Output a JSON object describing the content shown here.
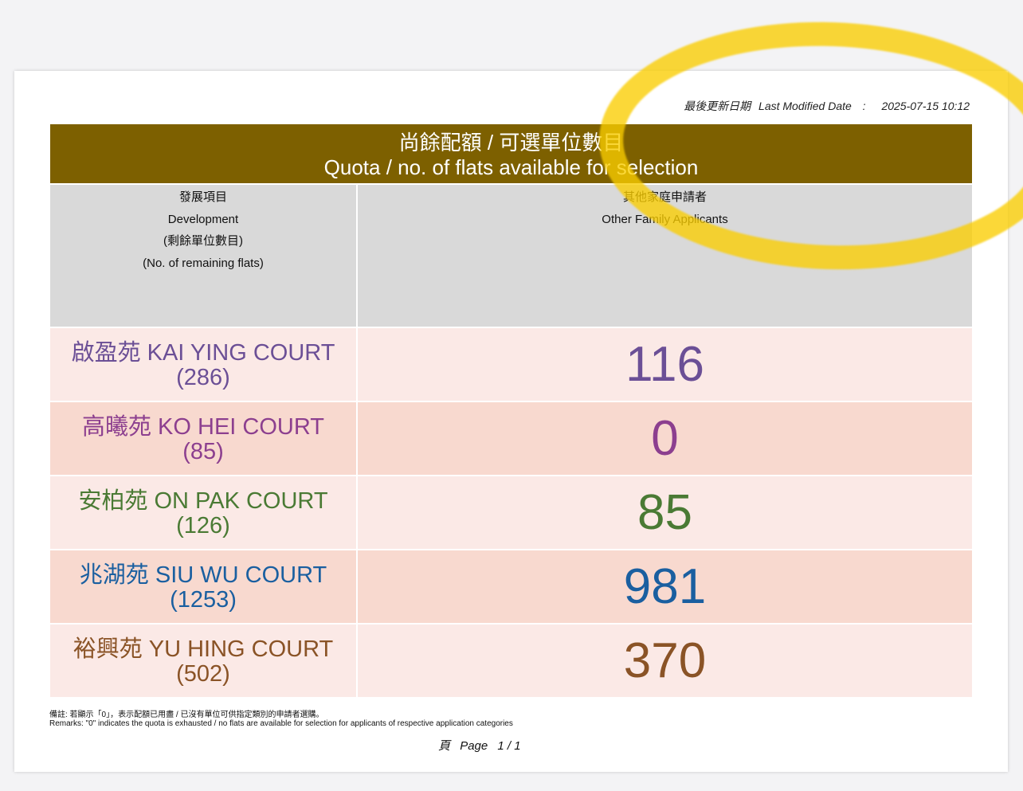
{
  "last_modified": {
    "label_zh": "最後更新日期",
    "label_en": "Last Modified Date",
    "separator": ":",
    "value": "2025-07-15 10:12"
  },
  "title": {
    "zh": "尚餘配額 / 可選單位數目",
    "en": "Quota / no. of flats available for selection"
  },
  "columns": {
    "development": {
      "zh": "發展項目",
      "en": "Development",
      "sub_zh": "(剩餘單位數目)",
      "sub_en": "(No. of remaining flats)"
    },
    "other_family": {
      "zh": "其他家庭申請者",
      "en": "Other Family Applicants"
    }
  },
  "rows": [
    {
      "name": "啟盈苑 KAI YING COURT",
      "remaining": "(286)",
      "quota": "116",
      "color": "#6b4f96"
    },
    {
      "name": "高曦苑 KO HEI COURT",
      "remaining": "(85)",
      "quota": "0",
      "color": "#8c3f8f"
    },
    {
      "name": "安柏苑 ON PAK COURT",
      "remaining": "(126)",
      "quota": "85",
      "color": "#4a7a34"
    },
    {
      "name": "兆湖苑 SIU WU COURT",
      "remaining": "(1253)",
      "quota": "981",
      "color": "#1a5fa0"
    },
    {
      "name": "裕興苑 YU HING COURT",
      "remaining": "(502)",
      "quota": "370",
      "color": "#8a5326"
    }
  ],
  "remarks": {
    "zh": "備註: 若顯示「0」，表示配額已用盡 / 已沒有單位可供指定類別的申請者選購。",
    "en": "Remarks: \"0\" indicates the quota is exhausted / no flats are available for selection for applicants of respective application categories"
  },
  "page": {
    "label_zh": "頁",
    "label_en": "Page",
    "value": "1 / 1"
  },
  "colors": {
    "title_bar": "#7d6000",
    "header_bg": "#d9d9d9",
    "row_light": "#fbe9e6",
    "row_dark": "#f8d9cf",
    "highlight": "#f5c800"
  }
}
